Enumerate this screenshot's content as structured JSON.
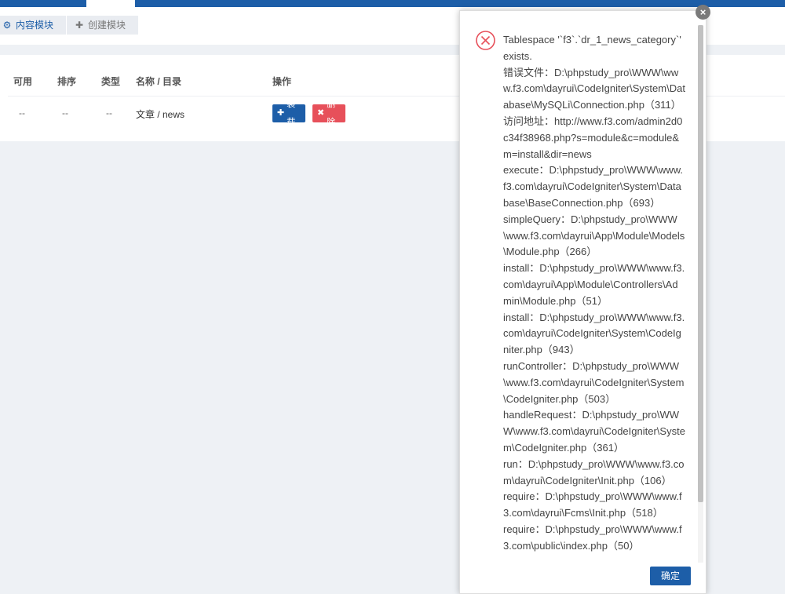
{
  "toolbar": {
    "tab_content_modules": "内容模块",
    "tab_create_module": "创建模块",
    "icons": {
      "active": "cogs-icon",
      "create": "plus-icon"
    }
  },
  "table": {
    "headers": [
      "可用",
      "排序",
      "类型",
      "名称 / 目录",
      "操作"
    ],
    "row": {
      "available": "--",
      "order": "--",
      "type": "--",
      "name": "文章 / news",
      "install_label": "装载",
      "delete_label": "删除"
    }
  },
  "dialog": {
    "lines": [
      "Tablespace '`f3`.`dr_1_news_category`' exists.",
      "错误文件：D:\\phpstudy_pro\\WWW\\www.f3.com\\dayrui\\CodeIgniter\\System\\Database\\MySQLi\\Connection.php（311）",
      "访问地址：http://www.f3.com/admin2d0c34f38968.php?s=module&c=module&m=install&dir=news",
      "execute：D:\\phpstudy_pro\\WWW\\www.f3.com\\dayrui\\CodeIgniter\\System\\Database\\BaseConnection.php（693）",
      "simpleQuery：D:\\phpstudy_pro\\WWW\\www.f3.com\\dayrui\\App\\Module\\Models\\Module.php（266）",
      "install：D:\\phpstudy_pro\\WWW\\www.f3.com\\dayrui\\App\\Module\\Controllers\\Admin\\Module.php（51）",
      "install：D:\\phpstudy_pro\\WWW\\www.f3.com\\dayrui\\CodeIgniter\\System\\CodeIgniter.php（943）",
      "runController：D:\\phpstudy_pro\\WWW\\www.f3.com\\dayrui\\CodeIgniter\\System\\CodeIgniter.php（503）",
      "handleRequest：D:\\phpstudy_pro\\WWW\\www.f3.com\\dayrui\\CodeIgniter\\System\\CodeIgniter.php（361）",
      "run：D:\\phpstudy_pro\\WWW\\www.f3.com\\dayrui\\CodeIgniter\\Init.php（106）",
      "require：D:\\phpstudy_pro\\WWW\\www.f3.com\\dayrui\\Fcms\\Init.php（518）",
      "require：D:\\phpstudy_pro\\WWW\\www.f3.com\\public\\index.php（50）"
    ],
    "ok_label": "确定",
    "close_symbol": "×"
  },
  "colors": {
    "brand": "#1d5ea8",
    "danger": "#e7505a",
    "error_icon": "#e7505a"
  }
}
